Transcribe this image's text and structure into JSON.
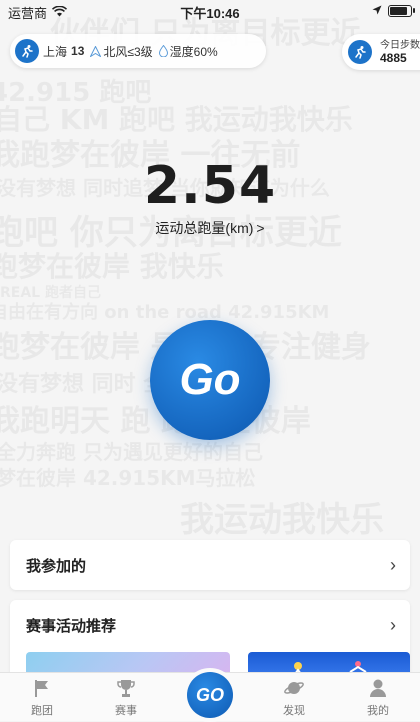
{
  "status_bar": {
    "carrier": "运营商",
    "time": "下午10:46"
  },
  "weather": {
    "city": "上海",
    "temperature": "13",
    "wind": "北风≤3级",
    "humidity": "湿度60%"
  },
  "steps": {
    "label": "今日步数",
    "value": "4885"
  },
  "distance": {
    "value": "2.54",
    "label": "运动总跑量(km)"
  },
  "go_button": {
    "label": "Go"
  },
  "background_slogans": [
    "伙伴们 只为离目标更近",
    "42.915 跑吧",
    "自己 KM 跑吧 我运动我快乐",
    "我跑梦在彼岸 一往无前",
    "没有梦想 同时追梦 当你就知道为什么",
    "跑吧 你只为离目标更近",
    "跑梦在彼岸 我快乐",
    "REAL 跑者自己",
    "自由在有方向 on the road 42.915KM",
    "跑梦在彼岸 是跑步 专注健身",
    "没有梦想 同时 全力奔跑",
    "我跑明天 跑 跑梦在彼岸",
    "全力奔跑 只为遇见更好的自己",
    "梦在彼岸 42.915KM马拉松",
    "我运动我快乐"
  ],
  "cards": {
    "joined": {
      "title": "我参加的"
    },
    "recommend": {
      "title": "赛事活动推荐"
    }
  },
  "tabbar": {
    "items": [
      {
        "label": "跑团",
        "icon": "flag-icon"
      },
      {
        "label": "赛事",
        "icon": "trophy-icon"
      },
      {
        "label": "GO",
        "icon": "go-icon"
      },
      {
        "label": "发现",
        "icon": "planet-icon"
      },
      {
        "label": "我的",
        "icon": "person-icon"
      }
    ]
  },
  "colors": {
    "brand_blue": "#1566bf",
    "background": "#f5f5f5"
  }
}
